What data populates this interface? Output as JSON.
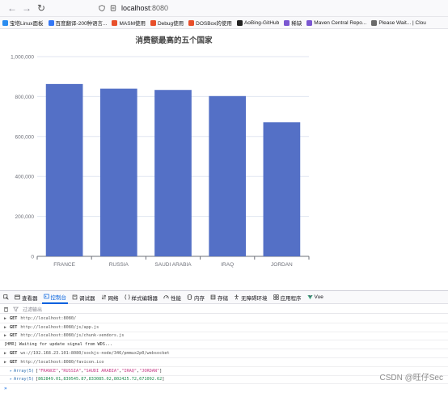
{
  "browser": {
    "url_host": "localhost",
    "url_port": ":8080",
    "bookmarks": [
      {
        "label": "宝塔Linux面板",
        "color": "#2a8cf0"
      },
      {
        "label": "百度翻译-200种语言...",
        "color": "#3478f6"
      },
      {
        "label": "MASM使用",
        "color": "#e8502b"
      },
      {
        "label": "Debug使用",
        "color": "#e8502b"
      },
      {
        "label": "DOSBox的使用",
        "color": "#e8502b"
      },
      {
        "label": "AoBing-GitHub",
        "color": "#222222"
      },
      {
        "label": "稀缺",
        "color": "#7a57d1"
      },
      {
        "label": "Maven Central Repo...",
        "color": "#7a57d1"
      },
      {
        "label": "Please Wait... | Clou",
        "color": "#6a6a6a"
      }
    ]
  },
  "chart_data": {
    "type": "bar",
    "title": "消费额最高的五个国家",
    "categories": [
      "FRANCE",
      "RUSSIA",
      "SAUDI ARABIA",
      "IRAQ",
      "JORDAN"
    ],
    "values": [
      862849.01,
      839545.87,
      833085.02,
      802425.72,
      671092.62
    ],
    "ylim": [
      0,
      1000000
    ],
    "yticks": [
      0,
      200000,
      400000,
      600000,
      800000,
      1000000
    ],
    "ytick_labels": [
      "0",
      "200,000",
      "400,000",
      "600,000",
      "800,000",
      "1,000,000"
    ],
    "bar_color": "#5470c6",
    "grid": true
  },
  "devtools": {
    "tabs": [
      {
        "label": "查看器",
        "icon": "inspector-icon"
      },
      {
        "label": "控制台",
        "icon": "console-icon",
        "active": true
      },
      {
        "label": "调试器",
        "icon": "debugger-icon"
      },
      {
        "label": "网络",
        "icon": "network-icon"
      },
      {
        "label": "样式编辑器",
        "icon": "style-editor-icon"
      },
      {
        "label": "性能",
        "icon": "performance-icon"
      },
      {
        "label": "内存",
        "icon": "memory-icon"
      },
      {
        "label": "存储",
        "icon": "storage-icon"
      },
      {
        "label": "无障碍环境",
        "icon": "accessibility-icon"
      },
      {
        "label": "应用程序",
        "icon": "application-icon"
      },
      {
        "label": "Vue",
        "icon": "vue-icon"
      }
    ],
    "filter_placeholder": "过滤输出",
    "console": {
      "get1": {
        "method": "GET",
        "url": "http://localhost:8080/"
      },
      "get2": {
        "method": "GET",
        "url": "http://localhost:8080/js/app.js"
      },
      "get3": {
        "method": "GET",
        "url": "http://localhost:8080/js/chunk-vendors.js"
      },
      "hmr": "[HMR] Waiting for update signal from WDS...",
      "get4": {
        "method": "GET",
        "url": "ws://192.168.23.101:8080/sockjs-node/346/pmmux2p0/websocket"
      },
      "get5": {
        "method": "GET",
        "url": "http://localhost:8080/favicon.ico"
      },
      "array1": {
        "name": "Array(5)",
        "items": [
          "\"FRANCE\"",
          "\"RUSSIA\"",
          "\"SAUDI ARABIA\"",
          "\"IRAQ\"",
          "\"JORDAN\""
        ]
      },
      "array2": {
        "name": "Array(5)",
        "items": [
          "862849.01",
          "839545.87",
          "833085.02",
          "802425.72",
          "671092.62"
        ]
      }
    }
  },
  "watermark": "CSDN @旺仔Sec"
}
